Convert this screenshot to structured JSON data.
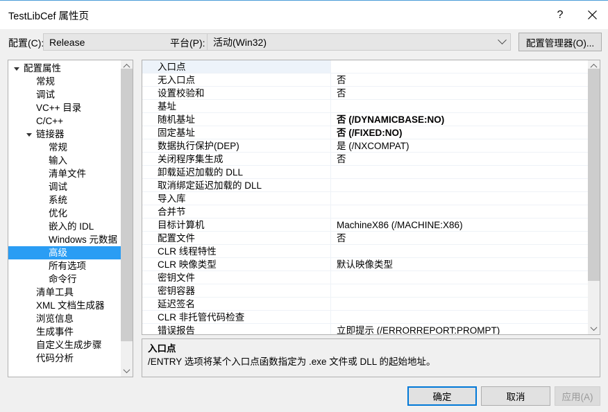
{
  "window": {
    "title": "TestLibCef 属性页",
    "help_label": "?",
    "close_label": "×",
    "accent_color": "#0078d7",
    "selection_color": "#2a9df4"
  },
  "config_bar": {
    "configuration_label": "配置(C):",
    "configuration_value": "Release",
    "platform_label": "平台(P):",
    "platform_value": "活动(Win32)",
    "config_manager_button": "配置管理器(O)..."
  },
  "tree": {
    "items": [
      {
        "label": "配置属性",
        "indent": 0,
        "twisty": "expanded",
        "selected": false
      },
      {
        "label": "常规",
        "indent": 1,
        "twisty": "none",
        "selected": false
      },
      {
        "label": "调试",
        "indent": 1,
        "twisty": "none",
        "selected": false
      },
      {
        "label": "VC++ 目录",
        "indent": 1,
        "twisty": "none",
        "selected": false
      },
      {
        "label": "C/C++",
        "indent": 1,
        "twisty": "collapsed",
        "selected": false
      },
      {
        "label": "链接器",
        "indent": 1,
        "twisty": "expanded",
        "selected": false
      },
      {
        "label": "常规",
        "indent": 2,
        "twisty": "none",
        "selected": false
      },
      {
        "label": "输入",
        "indent": 2,
        "twisty": "none",
        "selected": false
      },
      {
        "label": "清单文件",
        "indent": 2,
        "twisty": "none",
        "selected": false
      },
      {
        "label": "调试",
        "indent": 2,
        "twisty": "none",
        "selected": false
      },
      {
        "label": "系统",
        "indent": 2,
        "twisty": "none",
        "selected": false
      },
      {
        "label": "优化",
        "indent": 2,
        "twisty": "none",
        "selected": false
      },
      {
        "label": "嵌入的 IDL",
        "indent": 2,
        "twisty": "none",
        "selected": false
      },
      {
        "label": "Windows 元数据",
        "indent": 2,
        "twisty": "none",
        "selected": false
      },
      {
        "label": "高级",
        "indent": 2,
        "twisty": "none",
        "selected": true
      },
      {
        "label": "所有选项",
        "indent": 2,
        "twisty": "none",
        "selected": false
      },
      {
        "label": "命令行",
        "indent": 2,
        "twisty": "none",
        "selected": false
      },
      {
        "label": "清单工具",
        "indent": 1,
        "twisty": "collapsed",
        "selected": false
      },
      {
        "label": "XML 文档生成器",
        "indent": 1,
        "twisty": "collapsed",
        "selected": false
      },
      {
        "label": "浏览信息",
        "indent": 1,
        "twisty": "collapsed",
        "selected": false
      },
      {
        "label": "生成事件",
        "indent": 1,
        "twisty": "collapsed",
        "selected": false
      },
      {
        "label": "自定义生成步骤",
        "indent": 1,
        "twisty": "collapsed",
        "selected": false
      },
      {
        "label": "代码分析",
        "indent": 1,
        "twisty": "collapsed",
        "selected": false
      }
    ]
  },
  "property_grid": {
    "rows": [
      {
        "name": "入口点",
        "value": "",
        "bold": false,
        "selected": true
      },
      {
        "name": "无入口点",
        "value": "否",
        "bold": false,
        "selected": false
      },
      {
        "name": "设置校验和",
        "value": "否",
        "bold": false,
        "selected": false
      },
      {
        "name": "基址",
        "value": "",
        "bold": false,
        "selected": false
      },
      {
        "name": "随机基址",
        "value": "否 (/DYNAMICBASE:NO)",
        "bold": true,
        "selected": false
      },
      {
        "name": "固定基址",
        "value": "否 (/FIXED:NO)",
        "bold": true,
        "selected": false
      },
      {
        "name": "数据执行保护(DEP)",
        "value": "是 (/NXCOMPAT)",
        "bold": false,
        "selected": false
      },
      {
        "name": "关闭程序集生成",
        "value": "否",
        "bold": false,
        "selected": false
      },
      {
        "name": "卸载延迟加载的 DLL",
        "value": "",
        "bold": false,
        "selected": false
      },
      {
        "name": "取消绑定延迟加载的 DLL",
        "value": "",
        "bold": false,
        "selected": false
      },
      {
        "name": "导入库",
        "value": "",
        "bold": false,
        "selected": false
      },
      {
        "name": "合并节",
        "value": "",
        "bold": false,
        "selected": false
      },
      {
        "name": "目标计算机",
        "value": "MachineX86 (/MACHINE:X86)",
        "bold": false,
        "selected": false
      },
      {
        "name": "配置文件",
        "value": "否",
        "bold": false,
        "selected": false
      },
      {
        "name": "CLR 线程特性",
        "value": "",
        "bold": false,
        "selected": false
      },
      {
        "name": "CLR 映像类型",
        "value": "默认映像类型",
        "bold": false,
        "selected": false
      },
      {
        "name": "密钥文件",
        "value": "",
        "bold": false,
        "selected": false
      },
      {
        "name": "密钥容器",
        "value": "",
        "bold": false,
        "selected": false
      },
      {
        "name": "延迟签名",
        "value": "",
        "bold": false,
        "selected": false
      },
      {
        "name": "CLR 非托管代码检查",
        "value": "",
        "bold": false,
        "selected": false
      },
      {
        "name": "错误报告",
        "value": "立即提示 (/ERRORREPORT:PROMPT)",
        "bold": false,
        "selected": false
      }
    ]
  },
  "description": {
    "title": "入口点",
    "body": "/ENTRY 选项将某个入口点函数指定为 .exe 文件或 DLL 的起始地址。"
  },
  "buttons": {
    "ok": "确定",
    "cancel": "取消",
    "apply": "应用(A)"
  }
}
